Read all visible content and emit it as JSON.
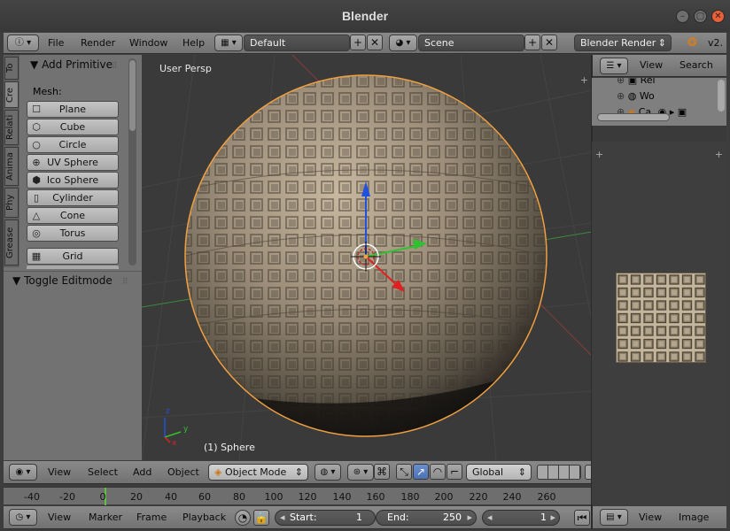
{
  "window": {
    "title": "Blender"
  },
  "info_header": {
    "menus": [
      "File",
      "Render",
      "Window",
      "Help"
    ],
    "layout": "Default",
    "scene": "Scene",
    "engine": "Blender Render",
    "version": "v2."
  },
  "tool_shelf": {
    "tabs": [
      "To",
      "Cre",
      "Relati",
      "Anima",
      "Phy",
      "Grease"
    ],
    "panel_title": "Add Primitive",
    "mesh_label": "Mesh:",
    "buttons": [
      "Plane",
      "Cube",
      "Circle",
      "UV Sphere",
      "Ico Sphere",
      "Cylinder",
      "Cone",
      "Torus",
      "Grid"
    ],
    "second_panel": "Toggle Editmode"
  },
  "viewport": {
    "label": "User Persp",
    "object_label": "(1) Sphere",
    "header": {
      "menus": [
        "View",
        "Select",
        "Add",
        "Object"
      ],
      "mode": "Object Mode",
      "orientation": "Global"
    },
    "axis_labels": {
      "x": "x",
      "y": "y",
      "z": "z"
    }
  },
  "outliner": {
    "header": {
      "view": "View",
      "search": "Search"
    },
    "rows": [
      "Rei",
      "Wo",
      "Ca"
    ]
  },
  "image_editor": {
    "header": {
      "view": "View",
      "image": "Image"
    }
  },
  "timeline": {
    "ticks": [
      "-40",
      "-20",
      "0",
      "20",
      "40",
      "60",
      "80",
      "100",
      "120",
      "140",
      "160",
      "180",
      "200",
      "220",
      "240",
      "260"
    ],
    "header": {
      "menus": [
        "View",
        "Marker",
        "Frame",
        "Playback"
      ],
      "start_label": "Start:",
      "start_value": "1",
      "end_label": "End:",
      "end_value": "250",
      "current_frame": "1"
    }
  },
  "colors": {
    "selection_outline": "#f0a040",
    "axis_x": "#e02020",
    "axis_y": "#30c030",
    "axis_z": "#2050e0",
    "accent_blue": "#5680c2"
  }
}
